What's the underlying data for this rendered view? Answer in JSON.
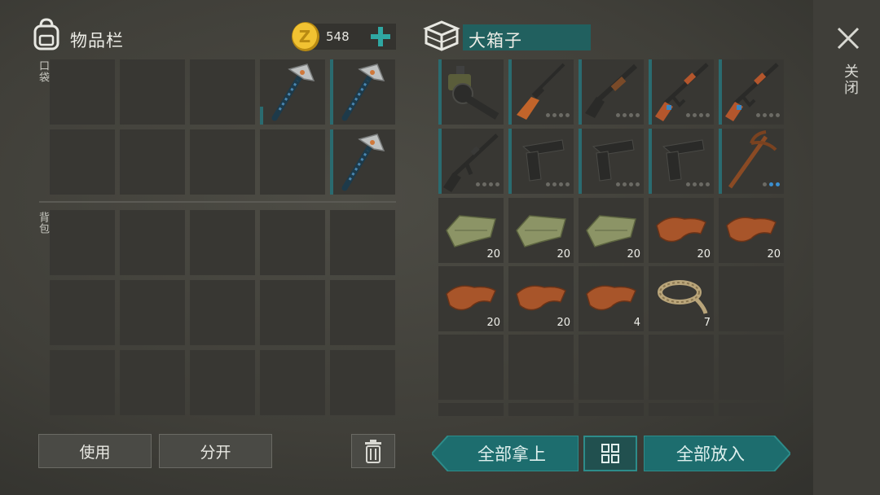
{
  "inventory": {
    "title": "物品栏",
    "coins": "548",
    "pocket_label": "口袋",
    "backpack_label": "背包",
    "use_label": "使用",
    "split_label": "分开"
  },
  "box": {
    "title": "大箱子",
    "take_all_label": "全部拿上",
    "put_all_label": "全部放入",
    "close_label": "关闭",
    "counts": {
      "r3c1": "20",
      "r3c2": "20",
      "r3c3": "20",
      "r3c4": "20",
      "r3c5": "20",
      "r4c1": "20",
      "r4c2": "20",
      "r4c3": "4",
      "r4c4": "7"
    }
  },
  "icons": {
    "backpack": "backpack-icon",
    "coin": "coin-icon",
    "add": "plus-icon",
    "box": "crate-icon",
    "close": "close-icon",
    "trash": "trash-icon",
    "sort": "sort-grid-icon"
  },
  "colors": {
    "accent": "#1d6d6e",
    "slot": "#383733",
    "coin": "#e6b427"
  }
}
